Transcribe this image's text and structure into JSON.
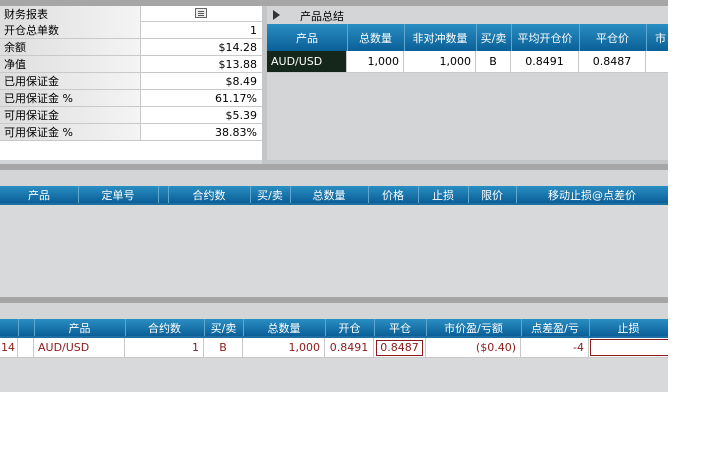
{
  "account": {
    "title": "财务报表",
    "menu_icon": "list-icon",
    "rows": [
      {
        "label": "开仓总单数",
        "value": "1"
      },
      {
        "label": "余额",
        "value": "$14.28"
      },
      {
        "label": "净值",
        "value": "$13.88"
      },
      {
        "label": "已用保证金",
        "value": "$8.49"
      },
      {
        "label": "已用保证金 %",
        "value": "61.17%"
      },
      {
        "label": "可用保证金",
        "value": "$5.39"
      },
      {
        "label": "可用保证金 %",
        "value": "38.83%"
      }
    ]
  },
  "summary": {
    "title": "产品总结",
    "expand_icon": "triangle-right-icon",
    "headers": [
      "产品",
      "总数量",
      "非对冲数量",
      "买/卖",
      "平均开仓价",
      "平仓价",
      "市"
    ],
    "row": {
      "product": "AUD/USD",
      "total": "1,000",
      "unhedged": "1,000",
      "side": "B",
      "avg_open": "0.8491",
      "close": "0.8487"
    }
  },
  "orders": {
    "headers": [
      "产品",
      "定单号",
      "合约数",
      "买/卖",
      "总数量",
      "价格",
      "止损",
      "限价",
      "移动止损@点差价"
    ]
  },
  "positions": {
    "headers": [
      "产品",
      "合约数",
      "买/卖",
      "总数量",
      "开仓",
      "平仓",
      "市价盈/亏额",
      "点差盈/亏",
      "止损"
    ],
    "row": {
      "id_tail": "14",
      "product": "AUD/USD",
      "contracts": "1",
      "side": "B",
      "total": "1,000",
      "open": "0.8491",
      "close": "0.8487",
      "pl": "($0.40)",
      "pips": "-4",
      "stop": ""
    }
  },
  "colors": {
    "header_blue": "#0a5f97",
    "gray_bg": "#d4d5d7",
    "dark_text": "#8b1a1a"
  }
}
